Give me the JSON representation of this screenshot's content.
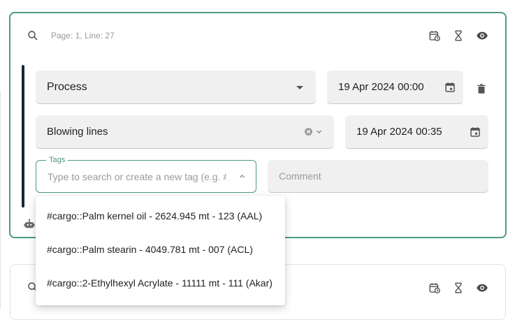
{
  "entry_card": {
    "header": {
      "location_text": "Page: 1, Line: 27",
      "icons": [
        "search-icon",
        "calendar-clock-icon",
        "hourglass-icon",
        "eye-icon"
      ]
    },
    "activity_select": {
      "value": "Process"
    },
    "start_datetime": {
      "value": "19 Apr 2024 00:00"
    },
    "subactivity_select": {
      "value": "Blowing lines"
    },
    "end_datetime": {
      "value": "19 Apr 2024 00:35"
    },
    "tags": {
      "label": "Tags",
      "placeholder": "Type to search or create a new tag (e.g. #"
    },
    "comment": {
      "placeholder": "Comment"
    }
  },
  "tag_options": [
    {
      "label": "#cargo::Palm kernel oil - 2624.945 mt - 123 (AAL)"
    },
    {
      "label": "#cargo::Palm stearin - 4049.781 mt - 007 (ACL)"
    },
    {
      "label": "#cargo::2-Ethylhexyl Acrylate - 11111 mt - 111 (Akar)"
    }
  ],
  "colors": {
    "accent_green": "#4e9a7d",
    "accent_bar_navy": "#12273b",
    "field_background": "#f0f0f0"
  }
}
